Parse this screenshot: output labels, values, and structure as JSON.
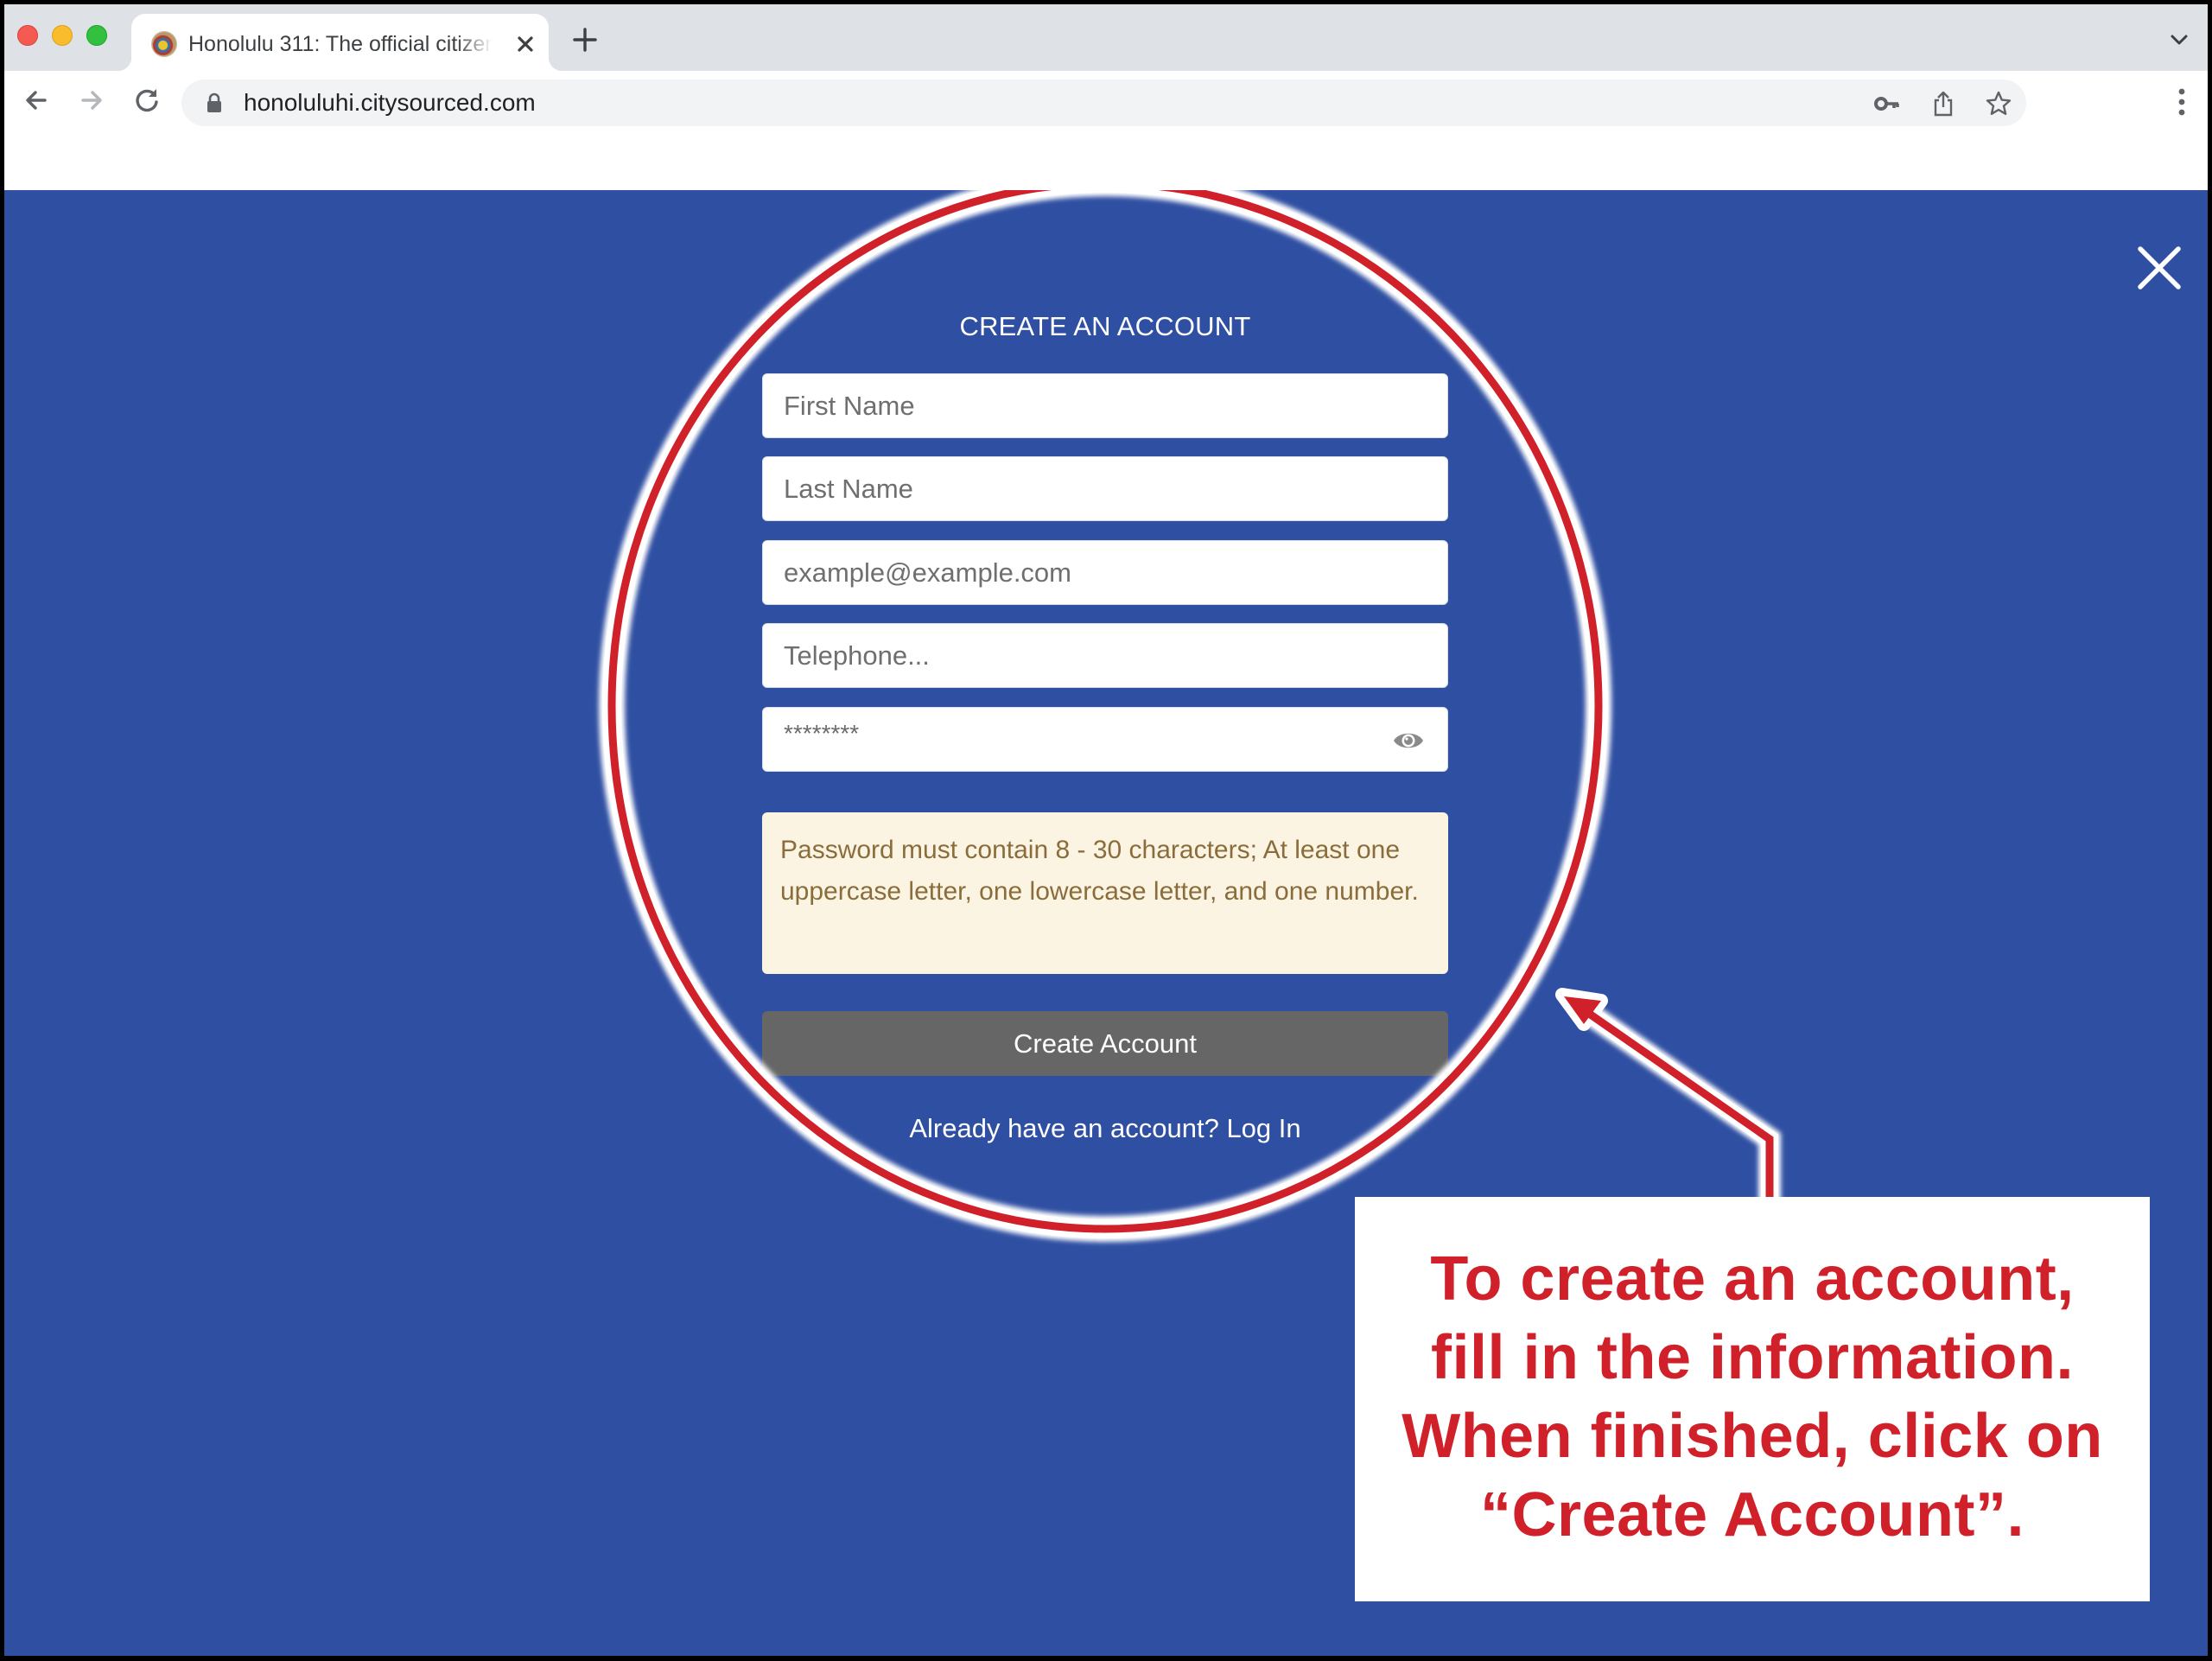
{
  "browser": {
    "tab": {
      "title": "Honolulu 311: The official citizen",
      "favicon": "city-seal-icon",
      "close_icon": "close-icon"
    },
    "new_tab_icon": "plus-icon",
    "tab_list_icon": "chevron-down-icon",
    "nav": {
      "back_icon": "arrow-left-icon",
      "forward_icon": "arrow-right-icon",
      "reload_icon": "reload-icon"
    },
    "address_bar": {
      "lock_icon": "lock-icon",
      "url": "honoluluhi.citysourced.com",
      "icons": [
        "key-icon",
        "share-icon",
        "star-icon"
      ]
    },
    "menu_icon": "vertical-dots-icon"
  },
  "modal": {
    "close_icon": "close-icon",
    "title": "CREATE AN ACCOUNT",
    "fields": {
      "first_name": {
        "placeholder": "First Name",
        "value": ""
      },
      "last_name": {
        "placeholder": "Last Name",
        "value": ""
      },
      "email": {
        "placeholder": "example@example.com",
        "value": ""
      },
      "telephone": {
        "placeholder": "Telephone...",
        "value": ""
      },
      "password": {
        "value": "********",
        "toggle_icon": "eye-icon"
      }
    },
    "password_hint": "Password must contain 8 - 30 characters; At least one uppercase letter, one lowercase letter, and one number.",
    "submit_label": "Create Account",
    "login_prompt": "Already have an account?",
    "login_link": "Log In"
  },
  "annotation": {
    "lines": [
      "To create an account,",
      "fill in the information.",
      "When finished, click on",
      "“Create Account”."
    ],
    "highlight": "ellipse",
    "pointer": "arrow"
  },
  "colors": {
    "page_background": "#2f4fa2",
    "annotation_red": "#d0202a",
    "button_gray": "#666666",
    "hint_background": "#fcf4e3",
    "hint_text": "#8a6d3b"
  }
}
